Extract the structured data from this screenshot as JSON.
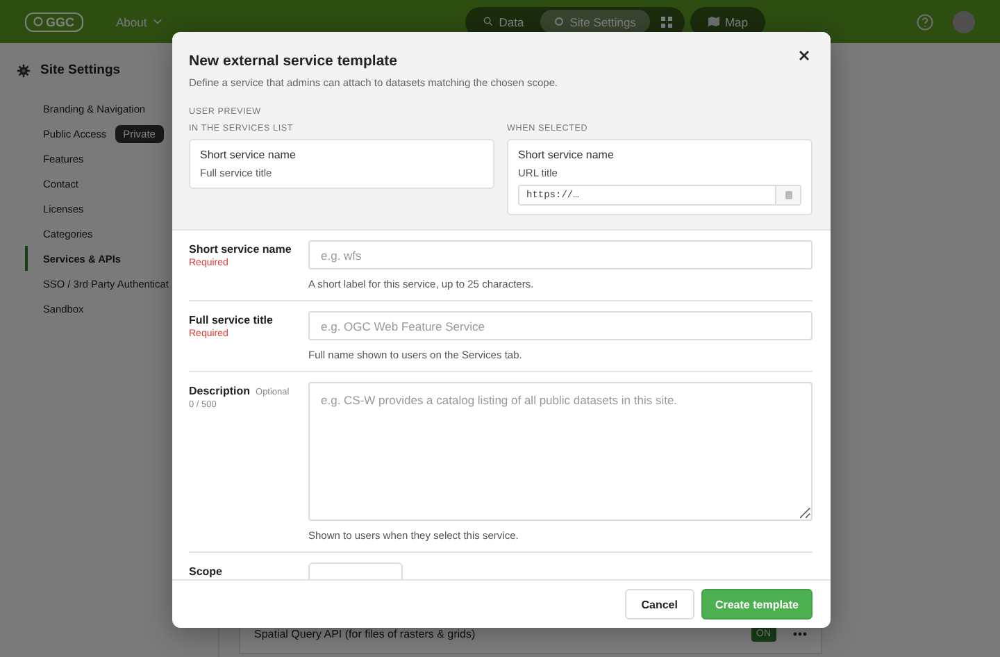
{
  "top_bar": {
    "logo": "GGC",
    "about_menu": "About",
    "nav_tabs": [
      {
        "label": "Data",
        "selected": false
      },
      {
        "label": "Site Settings",
        "selected": true
      }
    ],
    "map_tab": {
      "label": "Map",
      "selected": false
    }
  },
  "sidebar": {
    "title": "Site Settings",
    "items": [
      {
        "label": "Branding & Navigation",
        "selected": false
      },
      {
        "label": "Public Access",
        "selected": false,
        "badge": "Private"
      },
      {
        "label": "Features",
        "selected": false
      },
      {
        "label": "Contact",
        "selected": false
      },
      {
        "label": "Licenses",
        "selected": false
      },
      {
        "label": "Categories",
        "selected": false
      },
      {
        "label": "Services & APIs",
        "selected": true
      },
      {
        "label": "SSO / 3rd Party Authenticat",
        "selected": false
      },
      {
        "label": "Sandbox",
        "selected": false
      }
    ]
  },
  "service_rows": [
    {
      "name": "Spatial Query API (for files of rasters & grids)",
      "status": "ON",
      "on": true
    }
  ],
  "dialog": {
    "title": "New external service template",
    "subtitle": "Define a service that admins can attach to datasets matching the chosen scope.",
    "preview": {
      "heading": "USER PREVIEW",
      "list_label": "IN THE SERVICES LIST",
      "list_card": {
        "name": "Short service name",
        "title": "Full service title"
      },
      "selected_label": "WHEN SELECTED",
      "selected_card": {
        "name": "Short service name",
        "url_title": "URL title",
        "url_value": "https://…"
      }
    },
    "fields": [
      {
        "kind": "input",
        "label": "Short service name",
        "note": "Required",
        "required": true,
        "placeholder": "e.g. wfs",
        "help": "A short label for this service, up to 25 characters."
      },
      {
        "kind": "input",
        "label": "Full service title",
        "note": "Required",
        "required": true,
        "placeholder": "e.g. OGC Web Feature Service",
        "help": "Full name shown to users on the Services tab."
      },
      {
        "kind": "textarea",
        "label": "Description",
        "note": "Optional",
        "required": false,
        "counter": "0 / 500",
        "placeholder": "e.g. CS-W provides a catalog listing of all public datasets in this site.",
        "help": "Shown to users when they select this service."
      },
      {
        "kind": "select",
        "label": "Scope"
      }
    ],
    "buttons": [
      {
        "label": "Cancel",
        "kind": "secondary"
      },
      {
        "label": "Create template",
        "kind": "primary"
      }
    ]
  }
}
